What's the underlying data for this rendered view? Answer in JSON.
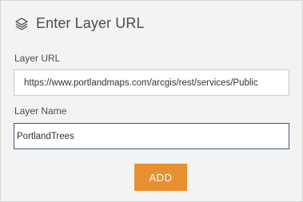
{
  "header": {
    "title": "Enter Layer URL",
    "icon": "layers-icon"
  },
  "form": {
    "url_label": "Layer URL",
    "url_value": "https://www.portlandmaps.com/arcgis/rest/services/Public",
    "name_label": "Layer Name",
    "name_value": "PortlandTrees"
  },
  "actions": {
    "add_label": "ADD"
  },
  "colors": {
    "accent": "#e88f2f",
    "panel_bg": "#f3f3f3",
    "focus_border": "#3c5a74"
  }
}
